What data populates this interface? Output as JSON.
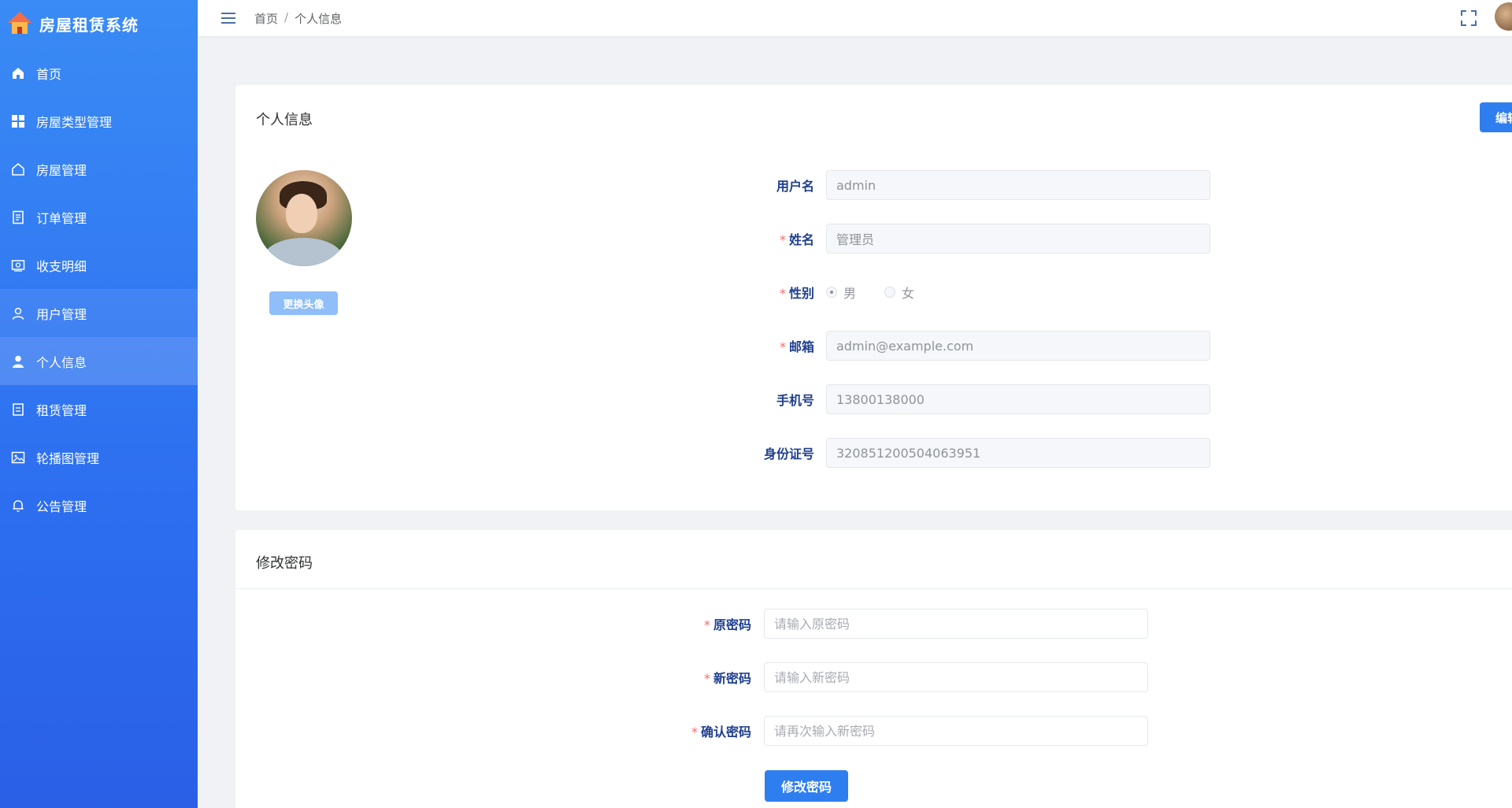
{
  "app": {
    "title": "房屋租赁系统"
  },
  "sidebar": {
    "items": [
      {
        "label": "首页",
        "icon": "home-icon"
      },
      {
        "label": "房屋类型管理",
        "icon": "grid-icon"
      },
      {
        "label": "房屋管理",
        "icon": "house-outline-icon"
      },
      {
        "label": "订单管理",
        "icon": "document-icon"
      },
      {
        "label": "收支明细",
        "icon": "finance-icon"
      },
      {
        "label": "用户管理",
        "icon": "user-outline-icon"
      },
      {
        "label": "个人信息",
        "icon": "user-filled-icon"
      },
      {
        "label": "租赁管理",
        "icon": "lease-icon"
      },
      {
        "label": "轮播图管理",
        "icon": "picture-icon"
      },
      {
        "label": "公告管理",
        "icon": "bell-icon"
      }
    ],
    "active_item": "个人信息"
  },
  "header": {
    "breadcrumb": [
      "首页",
      "个人信息"
    ],
    "breadcrumb_sep": "/"
  },
  "profile": {
    "title": "个人信息",
    "edit_label": "编辑",
    "change_avatar_label": "更换头像",
    "fields": {
      "username_label": "用户名",
      "username_value": "admin",
      "name_label": "姓名",
      "name_value": "管理员",
      "gender_label": "性别",
      "gender_options": [
        "男",
        "女"
      ],
      "gender_selected": "男",
      "email_label": "邮箱",
      "email_value": "admin@example.com",
      "phone_label": "手机号",
      "phone_value": "13800138000",
      "idcard_label": "身份证号",
      "idcard_value": "320851200504063951"
    },
    "required_mark": "*"
  },
  "password": {
    "title": "修改密码",
    "old_label": "原密码",
    "old_placeholder": "请输入原密码",
    "new_label": "新密码",
    "new_placeholder": "请输入新密码",
    "confirm_label": "确认密码",
    "confirm_placeholder": "请再次输入新密码",
    "submit_label": "修改密码"
  },
  "colors": {
    "primary": "#2f7ef0",
    "sidebar_top": "#3a8bf5",
    "sidebar_bottom": "#2a5fe6",
    "required": "#f56c6c"
  }
}
